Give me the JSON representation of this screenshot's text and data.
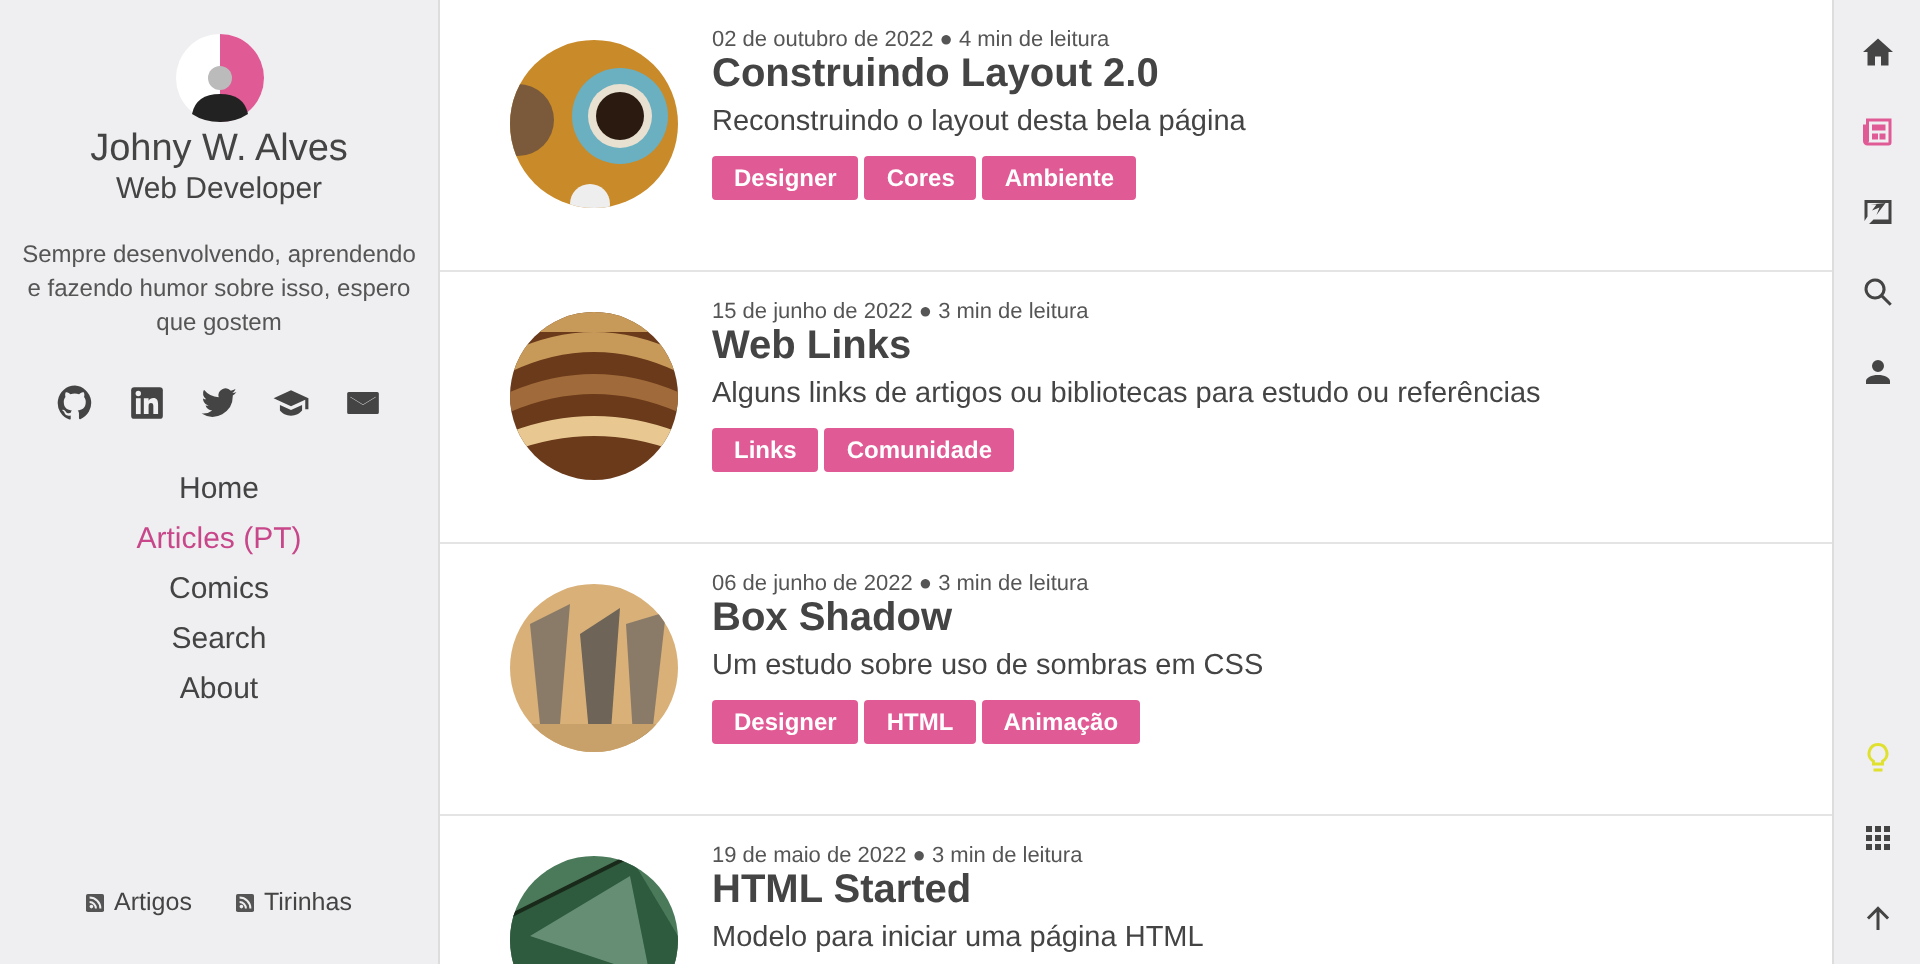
{
  "profile": {
    "name": "Johny W. Alves",
    "role": "Web Developer",
    "bio": "Sempre desenvolvendo, aprendendo e fazendo humor sobre isso, espero que gostem"
  },
  "social": [
    {
      "kind": "github"
    },
    {
      "kind": "linkedin"
    },
    {
      "kind": "twitter"
    },
    {
      "kind": "graduation"
    },
    {
      "kind": "mail"
    }
  ],
  "nav": [
    {
      "label": "Home",
      "selected": false
    },
    {
      "label": "Articles (PT)",
      "selected": true
    },
    {
      "label": "Comics",
      "selected": false
    },
    {
      "label": "Search",
      "selected": false
    },
    {
      "label": "About",
      "selected": false
    }
  ],
  "feeds": [
    "Artigos",
    "Tirinhas"
  ],
  "articles": [
    {
      "meta": "02 de outubro de 2022 ● 4 min de leitura",
      "title": "Construindo Layout 2.0",
      "description": "Reconstruindo o layout desta bela página",
      "tags": [
        "Designer",
        "Cores",
        "Ambiente"
      ]
    },
    {
      "meta": "15 de junho de 2022 ● 3 min de leitura",
      "title": "Web Links",
      "description": "Alguns links de artigos ou bibliotecas para estudo ou referências",
      "tags": [
        "Links",
        "Comunidade"
      ]
    },
    {
      "meta": "06 de junho de 2022 ● 3 min de leitura",
      "title": "Box Shadow",
      "description": "Um estudo sobre uso de sombras em CSS",
      "tags": [
        "Designer",
        "HTML",
        "Animação"
      ]
    },
    {
      "meta": "19 de maio de 2022 ● 3 min de leitura",
      "title": "HTML Started",
      "description": "Modelo para iniciar uma página HTML"
    }
  ],
  "rail": [
    {
      "kind": "home",
      "selected": false
    },
    {
      "kind": "articles",
      "selected": true
    },
    {
      "kind": "comics",
      "selected": false
    },
    {
      "kind": "search",
      "selected": false
    },
    {
      "kind": "about",
      "selected": false
    },
    {
      "kind": "spacer"
    },
    {
      "kind": "idea"
    },
    {
      "kind": "apps"
    },
    {
      "kind": "top"
    }
  ]
}
